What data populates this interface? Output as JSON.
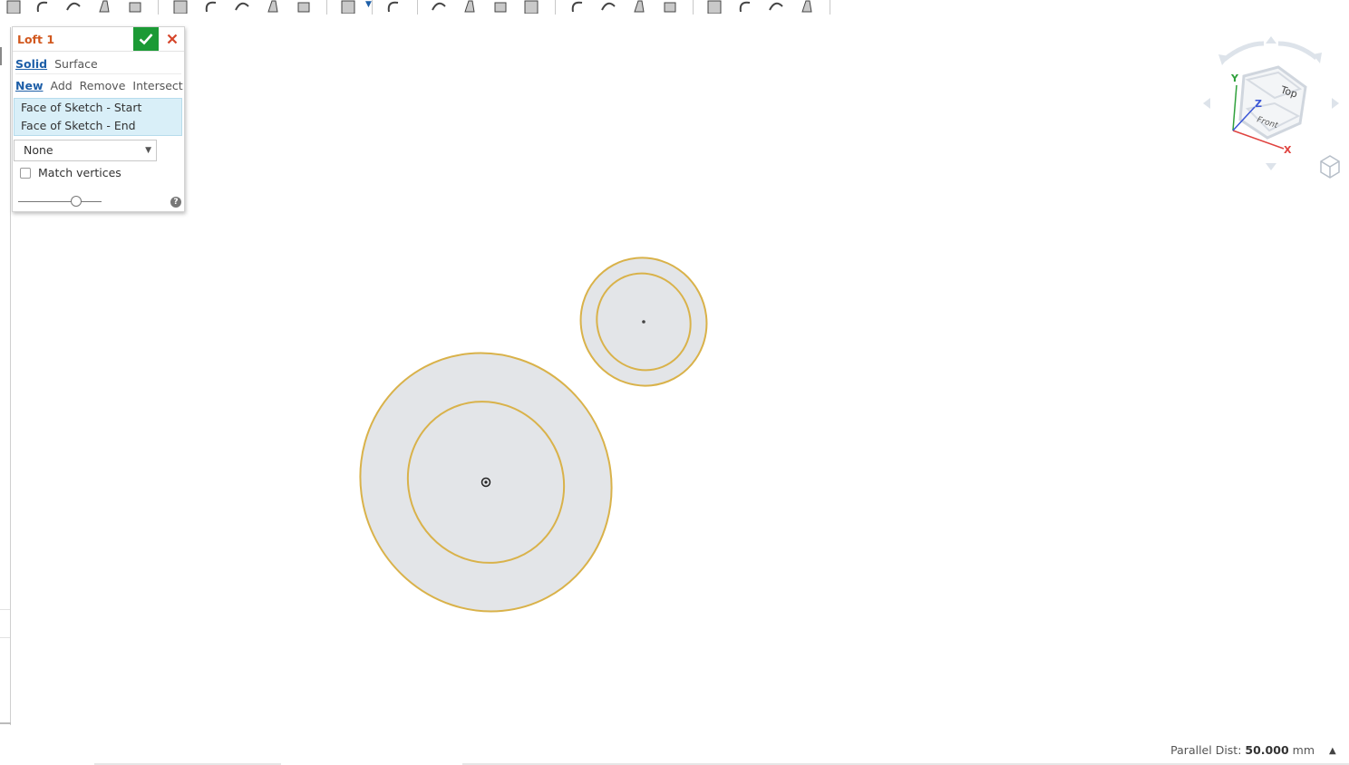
{
  "toolbar": {
    "icons": [
      "extrude-icon",
      "revolve-icon",
      "sweep-icon",
      "loft-icon",
      "thicken-icon",
      "fillet-icon",
      "chamfer-icon",
      "draft-icon",
      "shell-icon",
      "hole-icon",
      "pattern-icon",
      "mirror-icon",
      "boolean-icon",
      "split-icon",
      "transform-icon",
      "delete-part-icon",
      "modify-fillet-icon",
      "delete-face-icon",
      "move-face-icon",
      "replace-face-icon",
      "plane-icon",
      "helix-icon",
      "mate-connector-icon",
      "import-icon"
    ]
  },
  "dialog": {
    "title": "Loft 1",
    "body_type": {
      "solid": "Solid",
      "surface": "Surface"
    },
    "operations": {
      "new": "New",
      "add": "Add",
      "remove": "Remove",
      "intersect": "Intersect"
    },
    "selections": [
      "Face of Sketch - Start",
      "Face of Sketch - End"
    ],
    "end_condition": "None",
    "match_vertices_label": "Match vertices",
    "match_vertices_checked": false,
    "slider_fraction": 0.7,
    "help_label": "?"
  },
  "viewcube": {
    "faces": {
      "top": "Top",
      "front": "Front"
    },
    "axes": {
      "x": "X",
      "y": "Y",
      "z": "Z"
    },
    "colors": {
      "x": "#e0433f",
      "y": "#2ea03a",
      "z": "#3a56d6"
    }
  },
  "status": {
    "label": "Parallel Dist:",
    "value": "50.000",
    "unit": "mm"
  },
  "colors": {
    "accent_title": "#d1581e",
    "accept": "#1b9a35",
    "cancel": "#d6452a",
    "face_fill": "#e3e5e8",
    "edge": "#d9b24a",
    "link": "#1e5fa8"
  }
}
